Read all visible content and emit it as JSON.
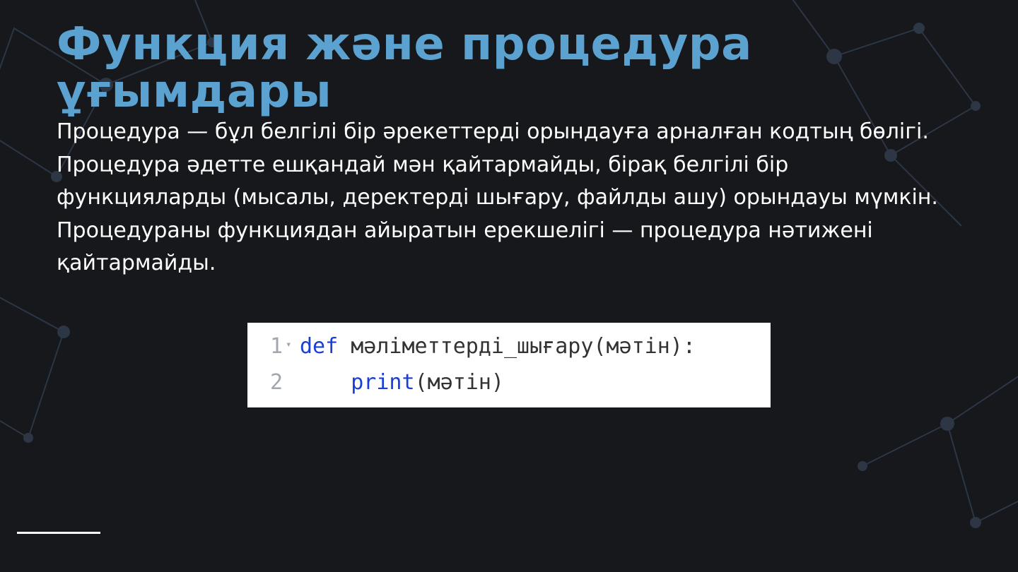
{
  "title": "Функция және процедура ұғымдары",
  "paragraph": "Процедура — бұл белгілі бір әрекеттерді орындауға арналған кодтың бөлігі. Процедура әдетте ешқандай мән қайтармайды, бірақ белгілі бір функцияларды (мысалы, деректерді шығару, файлды ашу) орындауы мүмкін. Процедураны функциядан айыратын ерекшелігі — процедура нәтижені қайтармайды.",
  "code": {
    "line1": {
      "num": "1",
      "kw": "def",
      "space_after_kw": " ",
      "rest": "мәліметтерді_шығару(мәтін):"
    },
    "line2": {
      "num": "2",
      "indent": "    ",
      "fn": "print",
      "rest": "(мәтін)"
    }
  }
}
